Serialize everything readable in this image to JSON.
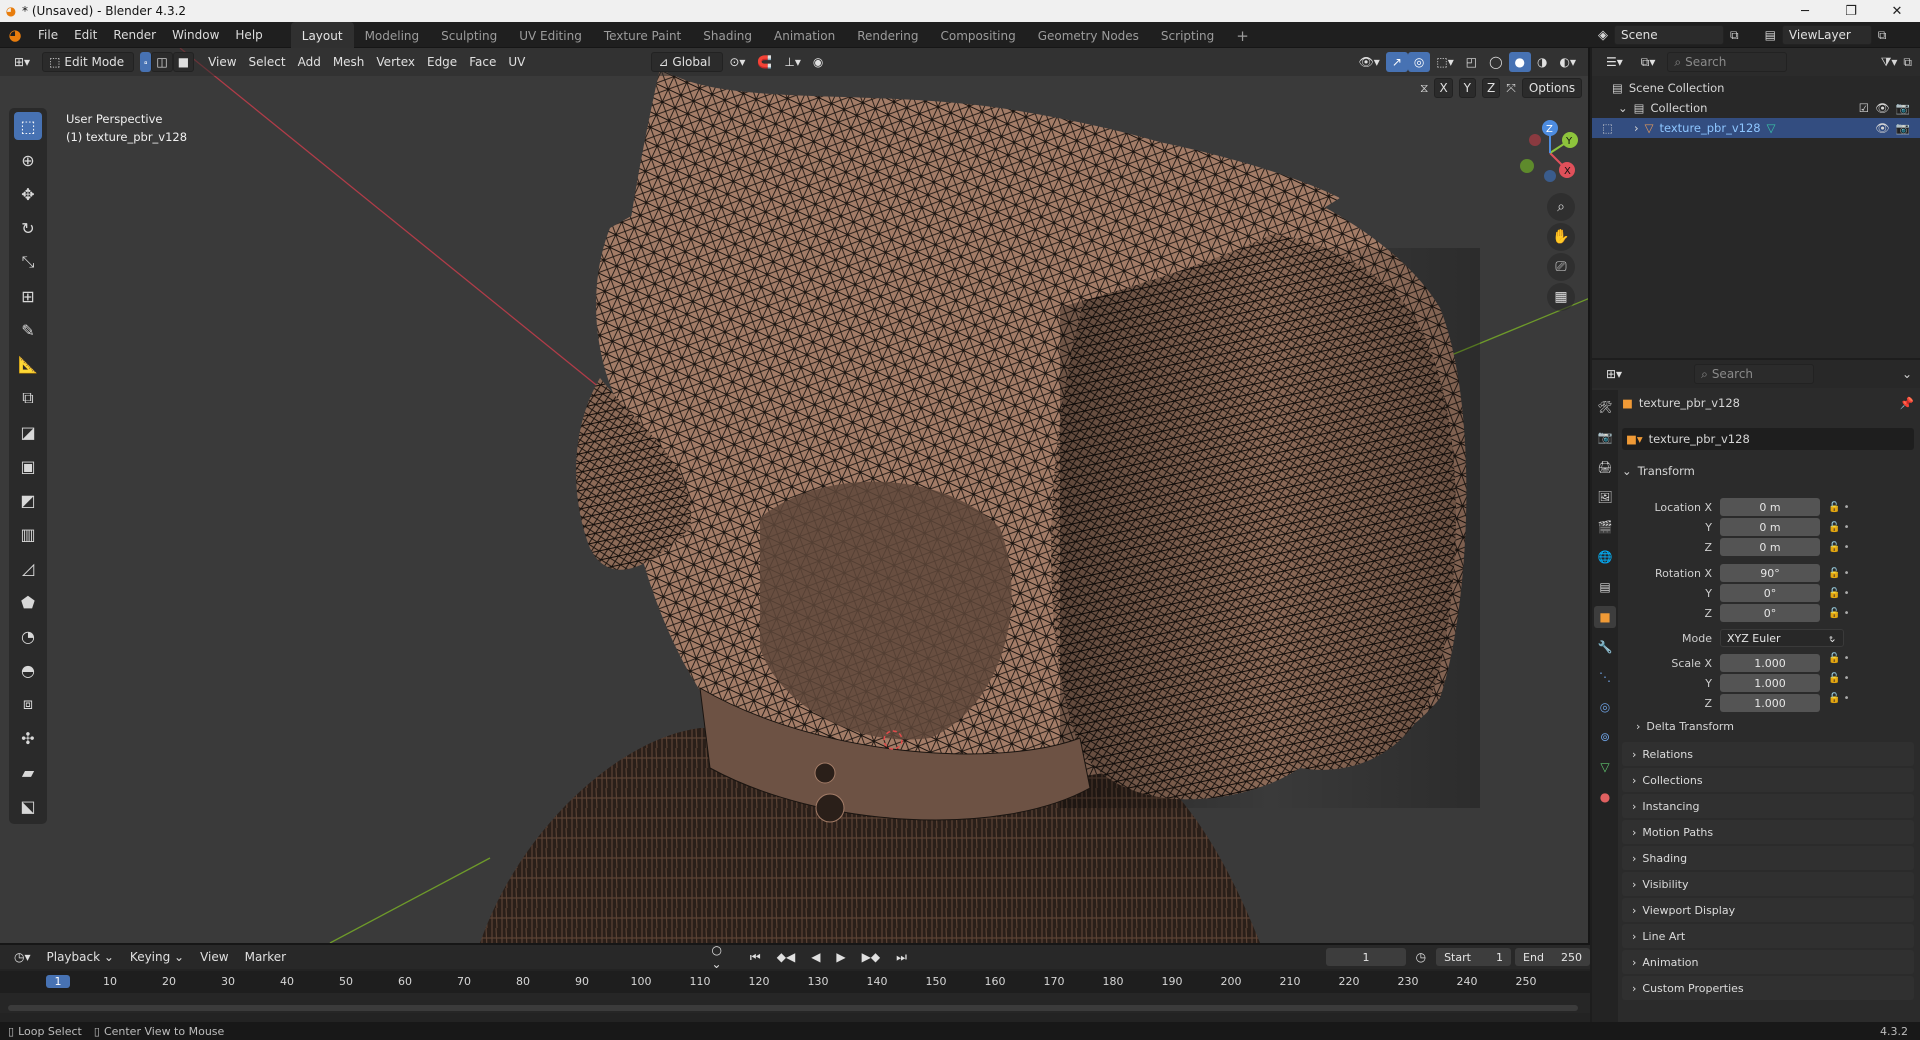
{
  "titlebar": {
    "title": "* (Unsaved) - Blender 4.3.2",
    "min": "─",
    "restore": "❐",
    "close": "✕"
  },
  "menu": [
    "File",
    "Edit",
    "Render",
    "Window",
    "Help"
  ],
  "workspaces": [
    "Layout",
    "Modeling",
    "Sculpting",
    "UV Editing",
    "Texture Paint",
    "Shading",
    "Animation",
    "Rendering",
    "Compositing",
    "Geometry Nodes",
    "Scripting"
  ],
  "add_workspace": "+",
  "scene": {
    "label": "Scene",
    "viewlayer": "ViewLayer"
  },
  "viewport": {
    "mode": "Edit Mode",
    "menus": [
      "View",
      "Select",
      "Add",
      "Mesh",
      "Vertex",
      "Edge",
      "Face",
      "UV"
    ],
    "orientation": "Global",
    "overlay_info": [
      "User Perspective",
      "(1) texture_pbr_v128"
    ],
    "axes": [
      "X",
      "Y",
      "Z"
    ],
    "options": "Options",
    "gizmo": {
      "z": "Z",
      "y": "Y",
      "x": "X"
    }
  },
  "outliner": {
    "search_placeholder": "Search",
    "scene_collection": "Scene Collection",
    "collection": "Collection",
    "object": "texture_pbr_v128"
  },
  "properties": {
    "search_placeholder": "Search",
    "object_name": "texture_pbr_v128",
    "data_name": "texture_pbr_v128",
    "transform_title": "Transform",
    "location_label": "Location X",
    "rotation_label": "Rotation X",
    "scale_label": "Scale X",
    "y_label": "Y",
    "z_label": "Z",
    "location": [
      "0 m",
      "0 m",
      "0 m"
    ],
    "rotation": [
      "90°",
      "0°",
      "0°"
    ],
    "mode_label": "Mode",
    "mode_value": "XYZ Euler",
    "scale": [
      "1.000",
      "1.000",
      "1.000"
    ],
    "delta": "Delta Transform",
    "panels": [
      "Relations",
      "Collections",
      "Instancing",
      "Motion Paths",
      "Shading",
      "Visibility",
      "Viewport Display",
      "Line Art",
      "Animation",
      "Custom Properties"
    ]
  },
  "timeline": {
    "menus": [
      "Playback",
      "Keying",
      "View",
      "Marker"
    ],
    "current_frame": "1",
    "start_label": "Start",
    "start": "1",
    "end_label": "End",
    "end": "250",
    "ticks": [
      "1",
      "10",
      "20",
      "30",
      "40",
      "50",
      "60",
      "70",
      "80",
      "90",
      "100",
      "110",
      "120",
      "130",
      "140",
      "150",
      "160",
      "170",
      "180",
      "190",
      "200",
      "210",
      "220",
      "230",
      "240",
      "250"
    ]
  },
  "status": {
    "left1": "Loop Select",
    "left2": "Center View to Mouse",
    "version": "4.3.2"
  },
  "colors": {
    "accent": "#4772b3",
    "mesh": "#a8806b",
    "wire": "#1a1410",
    "x_axis": "#b03c48",
    "y_axis": "#6e9a2a"
  }
}
